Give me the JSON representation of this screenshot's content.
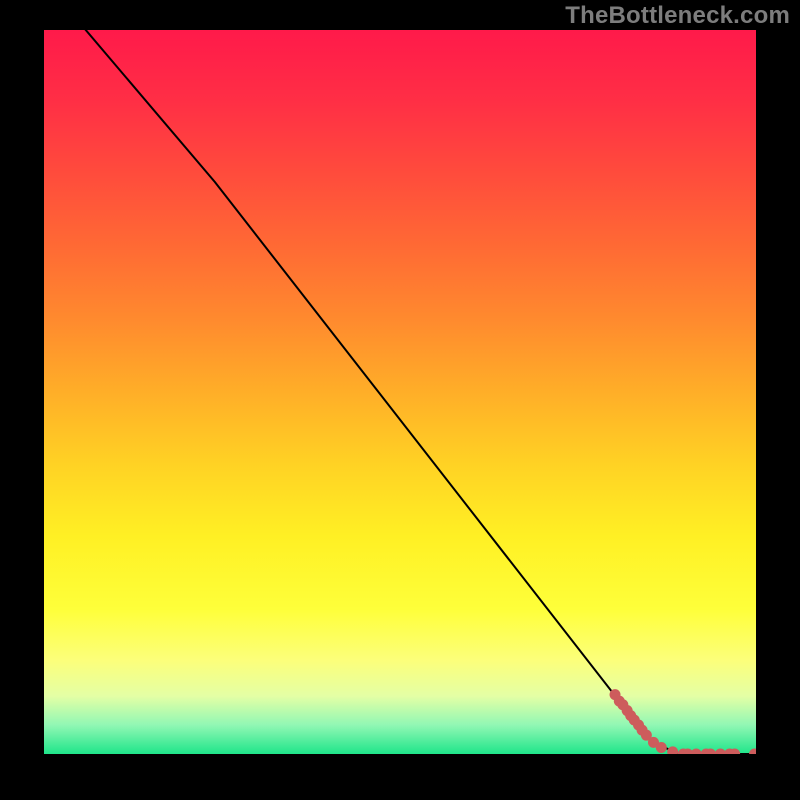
{
  "watermark": "TheBottleneck.com",
  "chart_data": {
    "type": "line",
    "title": "",
    "xlabel": "",
    "ylabel": "",
    "xlim": [
      0,
      100
    ],
    "ylim": [
      0,
      100
    ],
    "background_gradient_stops": [
      {
        "pct": 0.0,
        "color": "#ff1a4a"
      },
      {
        "pct": 0.1,
        "color": "#ff2f45"
      },
      {
        "pct": 0.2,
        "color": "#ff4c3c"
      },
      {
        "pct": 0.3,
        "color": "#ff6a34"
      },
      {
        "pct": 0.4,
        "color": "#ff8a2e"
      },
      {
        "pct": 0.5,
        "color": "#ffae28"
      },
      {
        "pct": 0.6,
        "color": "#ffd224"
      },
      {
        "pct": 0.7,
        "color": "#fff024"
      },
      {
        "pct": 0.8,
        "color": "#feff3a"
      },
      {
        "pct": 0.87,
        "color": "#fcff7a"
      },
      {
        "pct": 0.92,
        "color": "#e4ffa5"
      },
      {
        "pct": 0.96,
        "color": "#91f7b4"
      },
      {
        "pct": 1.0,
        "color": "#1fe58a"
      }
    ],
    "curve": {
      "name": "bottleneck-curve",
      "color": "#000000",
      "points": [
        {
          "x": 5,
          "y": 101
        },
        {
          "x": 24,
          "y": 79
        },
        {
          "x": 85,
          "y": 2
        },
        {
          "x": 89,
          "y": 0
        },
        {
          "x": 100,
          "y": 0
        }
      ]
    },
    "scatter": {
      "name": "datapoints",
      "color": "#cd5c5c",
      "radius_px": 5.5,
      "points": [
        {
          "x": 80.2,
          "y": 8.2
        },
        {
          "x": 80.8,
          "y": 7.3
        },
        {
          "x": 81.3,
          "y": 6.8
        },
        {
          "x": 81.9,
          "y": 6.0
        },
        {
          "x": 82.4,
          "y": 5.3
        },
        {
          "x": 82.9,
          "y": 4.7
        },
        {
          "x": 83.5,
          "y": 4.0
        },
        {
          "x": 84.0,
          "y": 3.3
        },
        {
          "x": 84.6,
          "y": 2.6
        },
        {
          "x": 85.6,
          "y": 1.6
        },
        {
          "x": 86.7,
          "y": 0.9
        },
        {
          "x": 88.3,
          "y": 0.3
        },
        {
          "x": 89.8,
          "y": 0.0
        },
        {
          "x": 90.4,
          "y": 0.0
        },
        {
          "x": 91.6,
          "y": 0.0
        },
        {
          "x": 93.0,
          "y": 0.0
        },
        {
          "x": 93.6,
          "y": 0.0
        },
        {
          "x": 95.0,
          "y": 0.0
        },
        {
          "x": 96.3,
          "y": 0.0
        },
        {
          "x": 97.0,
          "y": 0.0
        },
        {
          "x": 99.8,
          "y": 0.0
        }
      ]
    }
  }
}
